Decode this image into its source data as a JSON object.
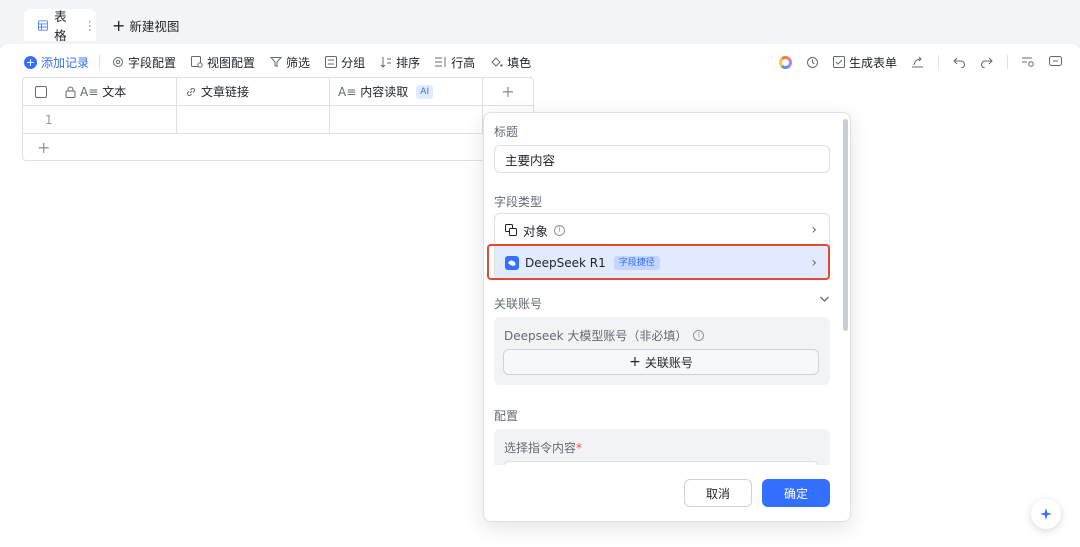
{
  "view_tabs": {
    "active_label": "表格",
    "more": "⋮",
    "new_view_label": "新建视图"
  },
  "toolbar": {
    "add_record": "添加记录",
    "field_config": "字段配置",
    "view_config": "视图配置",
    "filter": "筛选",
    "group": "分组",
    "sort": "排序",
    "row_height": "行高",
    "fill_color": "填色",
    "generate_form": "生成表单"
  },
  "grid": {
    "columns": [
      {
        "label": "文本",
        "icon": "text-field-icon",
        "locked": true
      },
      {
        "label": "文章链接",
        "icon": "link-icon"
      },
      {
        "label": "内容读取",
        "icon": "text-field-icon",
        "badge": "AI"
      }
    ],
    "rows": [
      {
        "index": "1"
      }
    ]
  },
  "panel": {
    "title_label": "标题",
    "title_value": "主要内容",
    "field_type_label": "字段类型",
    "type_object": "对象",
    "type_deepseek": "DeepSeek R1",
    "type_deepseek_tag": "字段捷径",
    "account_label": "关联账号",
    "account_title": "Deepseek 大模型账号（非必填）",
    "account_button": "关联账号",
    "config_label": "配置",
    "config_field": "选择指令内容",
    "config_required": "*",
    "cancel": "取消",
    "confirm": "确定"
  },
  "colors": {
    "accent": "#3370ff",
    "highlight": "#e24a34"
  }
}
